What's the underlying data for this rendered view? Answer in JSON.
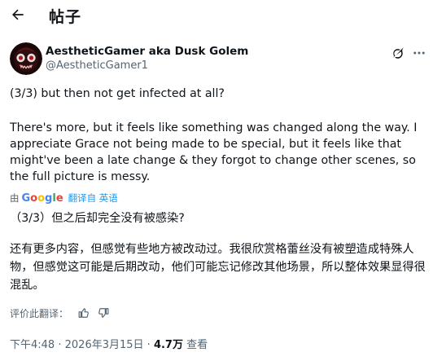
{
  "header": {
    "title": "帖子",
    "back_icon": "arrow-left-icon"
  },
  "author": {
    "name": "AestheticGamer aka Dusk Golem",
    "handle": "@AestheticGamer1"
  },
  "post": {
    "line1": "(3/3) but then not get infected at all?",
    "paragraph": "There's more, but it feels like something was changed along the way. I appreciate Grace not being made to be special, but it feels like that might've been a late change & they forgot to change other scenes, so the full picture is messy."
  },
  "translation": {
    "by_prefix": "由",
    "provider": "Google",
    "link_label": "翻译自 英语",
    "line1": "（3/3）但之后却完全没有被感染?",
    "paragraph": "还有更多内容，但感觉有些地方被改动过。我很欣赏格蕾丝没有被塑造成特殊人物，但感觉这可能是后期改动，他们可能忘记修改其他场景，所以整体效果显得很混乱。"
  },
  "rating": {
    "label": "评价此翻译："
  },
  "meta": {
    "time": "下午4:48",
    "date": "2026年3月15日",
    "separator": "·",
    "views_count": "4.7万",
    "views_label": "查看"
  },
  "colors": {
    "text": "#0f1419",
    "secondary": "#536471",
    "link": "#1d9bf0"
  }
}
